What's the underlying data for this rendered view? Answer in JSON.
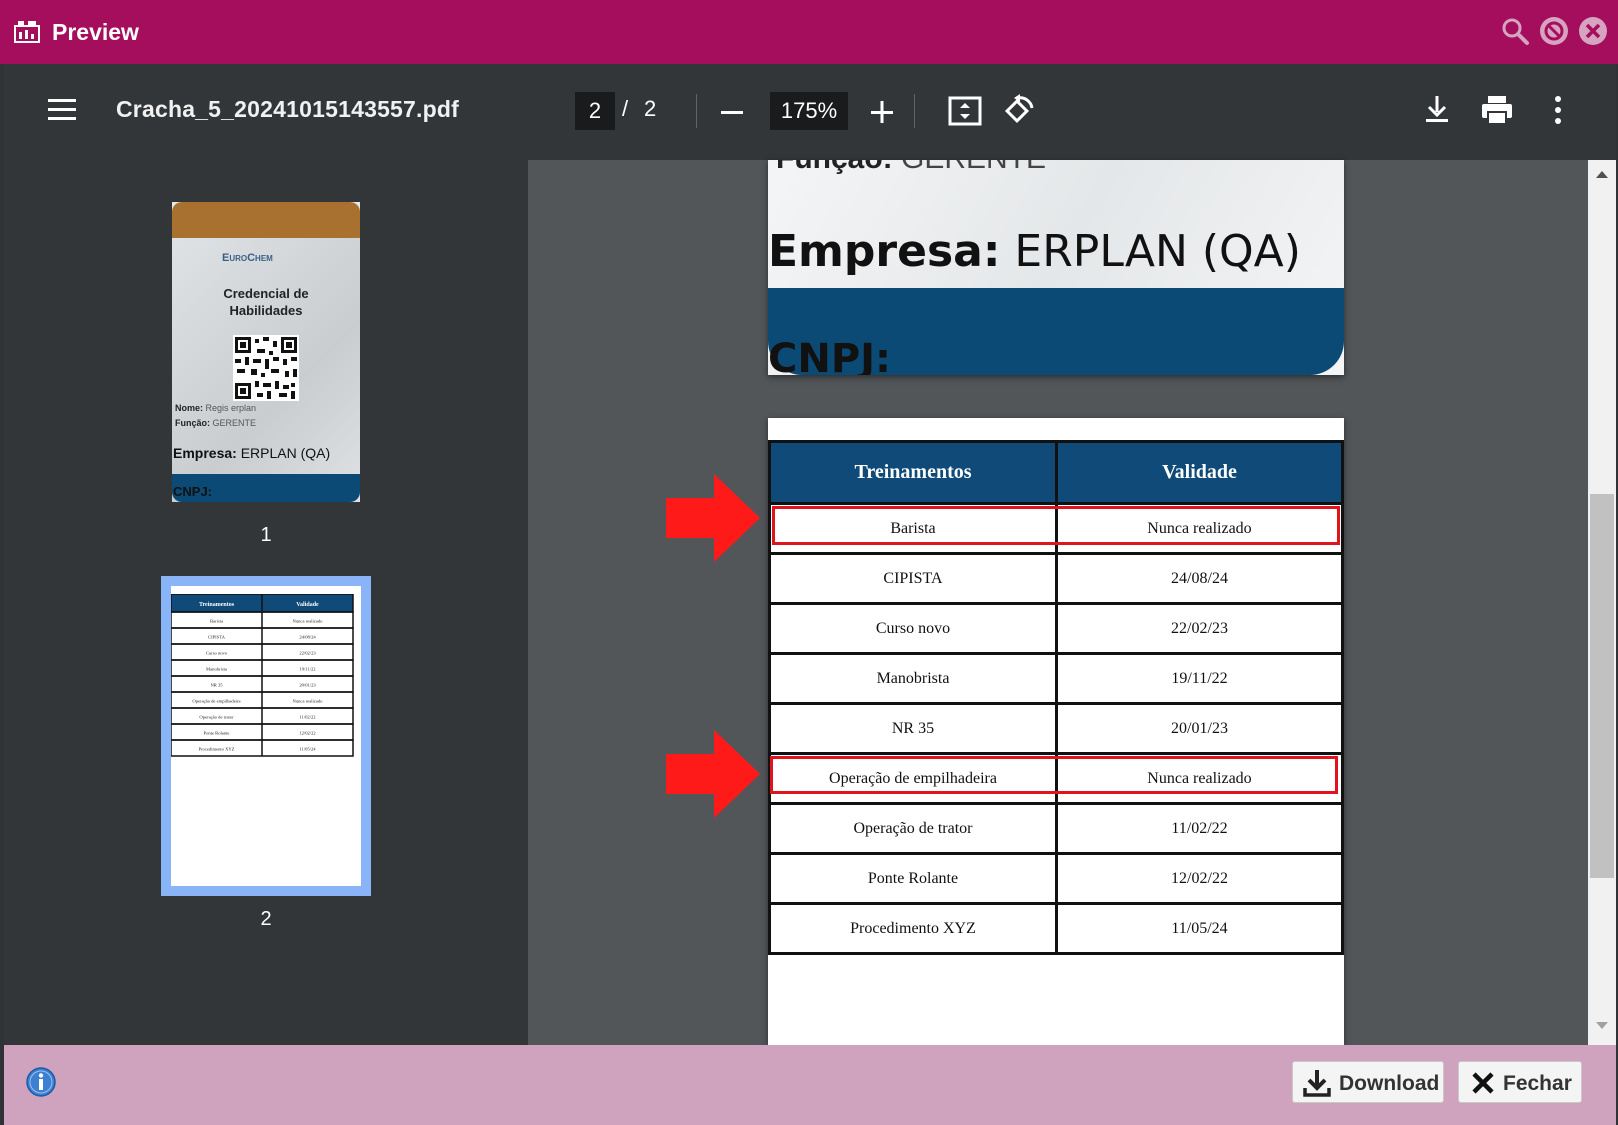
{
  "window": {
    "title": "Preview"
  },
  "toolbar": {
    "filename": "Cracha_5_20241015143557.pdf",
    "current_page": "2",
    "page_separator": "/",
    "total_pages": "2",
    "zoom": "175%"
  },
  "sidebar": {
    "thumbnails": [
      {
        "number": "1",
        "brand": "EuroChem",
        "heading_line1": "Credencial de",
        "heading_line2": "Habilidades",
        "nome_label": "Nome:",
        "nome_value": "Regis erplan",
        "funcao_label": "Função:",
        "funcao_value": "GERENTE",
        "empresa_label": "Empresa:",
        "empresa_value": "ERPLAN (QA)",
        "cnpj_label": "CNPJ:"
      },
      {
        "number": "2"
      }
    ]
  },
  "page1": {
    "funcao_label": "Função:",
    "funcao_value": "GERENTE",
    "empresa_label": "Empresa:",
    "empresa_value": "ERPLAN (QA)",
    "cnpj_label": "CNPJ:"
  },
  "table": {
    "headers": [
      "Treinamentos",
      "Validade"
    ],
    "rows": [
      [
        "Barista",
        "Nunca realizado"
      ],
      [
        "CIPISTA",
        "24/08/24"
      ],
      [
        "Curso novo",
        "22/02/23"
      ],
      [
        "Manobrista",
        "19/11/22"
      ],
      [
        "NR 35",
        "20/01/23"
      ],
      [
        "Operação de empilhadeira",
        "Nunca realizado"
      ],
      [
        "Operação de trator",
        "11/02/22"
      ],
      [
        "Ponte Rolante",
        "12/02/22"
      ],
      [
        "Procedimento XYZ",
        "11/05/24"
      ]
    ]
  },
  "footer": {
    "download_label": "Download",
    "close_label": "Fechar"
  },
  "colors": {
    "titlebar": "#a50d5d",
    "toolbar": "#323639",
    "viewer_bg": "#525659",
    "table_header": "#0f4a78",
    "highlight": "#e0141c",
    "footer": "#cfa3bd",
    "thumb_selected": "#8ab4f8"
  },
  "icons": {
    "app": "presentation-icon",
    "search": "search-icon",
    "minimize": "block-icon",
    "close": "close-circle-icon",
    "menu": "hamburger-icon",
    "zoom_out": "minus-icon",
    "zoom_in": "plus-icon",
    "fit": "fit-page-icon",
    "rotate": "rotate-icon",
    "download": "download-icon",
    "print": "print-icon",
    "more": "more-vertical-icon",
    "info": "info-icon",
    "arrow": "red-arrow-icon"
  }
}
